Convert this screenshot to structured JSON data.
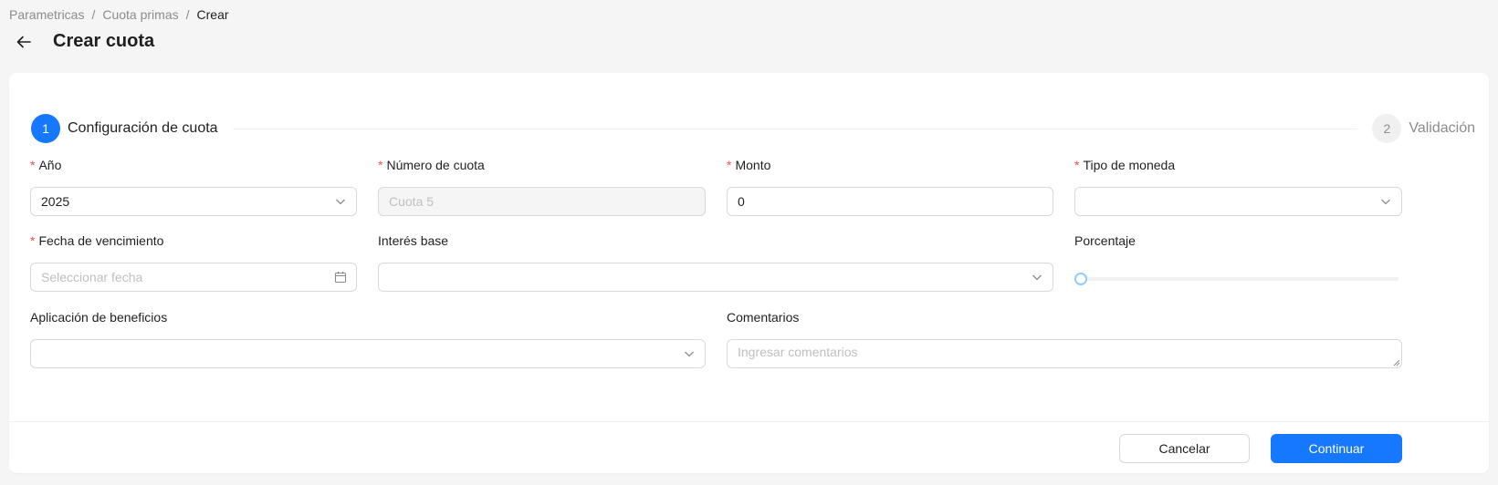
{
  "breadcrumb": {
    "items": [
      "Parametricas",
      "Cuota primas",
      "Crear"
    ],
    "separator": "/"
  },
  "header": {
    "title": "Crear cuota",
    "back_icon": "arrow-left-icon"
  },
  "steps": [
    {
      "number": "1",
      "title": "Configuración de cuota",
      "status": "active"
    },
    {
      "number": "2",
      "title": "Validación",
      "status": "inactive"
    }
  ],
  "form": {
    "anio": {
      "label": "Año",
      "required": true,
      "value": "2025",
      "icon": "chevron-down-icon"
    },
    "numero_cuota": {
      "label": "Número de cuota",
      "required": true,
      "placeholder": "Cuota 5",
      "disabled": true
    },
    "monto": {
      "label": "Monto",
      "required": true,
      "value": "0"
    },
    "tipo_moneda": {
      "label": "Tipo de moneda",
      "required": true,
      "value": "",
      "icon": "chevron-down-icon"
    },
    "fecha_vencimiento": {
      "label": "Fecha de vencimiento",
      "required": true,
      "placeholder": "Seleccionar fecha",
      "icon": "calendar-icon"
    },
    "interes_base": {
      "label": "Interés base",
      "required": false,
      "value": "",
      "icon": "chevron-down-icon"
    },
    "porcentaje": {
      "label": "Porcentaje",
      "required": false,
      "value": 0
    },
    "aplicacion_beneficios": {
      "label": "Aplicación de beneficios",
      "required": false,
      "value": "",
      "icon": "chevron-down-icon"
    },
    "comentarios": {
      "label": "Comentarios",
      "required": false,
      "placeholder": "Ingresar comentarios"
    }
  },
  "actions": {
    "cancel_label": "Cancelar",
    "continue_label": "Continuar"
  },
  "colors": {
    "primary": "#1677ff",
    "required": "#ff4d4f",
    "border": "#d9d9d9",
    "background": "#f5f5f5"
  }
}
